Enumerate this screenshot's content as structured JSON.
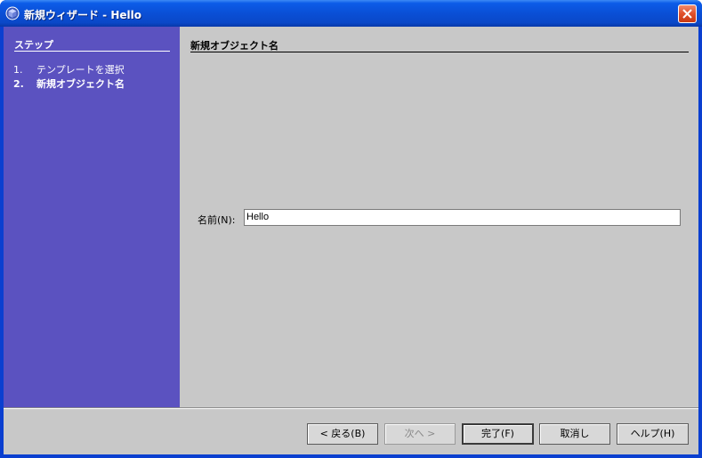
{
  "window": {
    "title": "新規ウィザード - Hello"
  },
  "steps": {
    "header": "ステップ",
    "items": [
      {
        "num": "1.",
        "label": "テンプレートを選択"
      },
      {
        "num": "2.",
        "label": "新規オブジェクト名"
      }
    ]
  },
  "content": {
    "header": "新規オブジェクト名",
    "name_label": "名前(N):",
    "name_value": "Hello"
  },
  "buttons": {
    "back": "< 戻る(B)",
    "next": "次へ >",
    "finish": "完了(F)",
    "cancel": "取消し",
    "help": "ヘルプ(H)"
  },
  "colors": {
    "titlebar": "#0a4fd6",
    "steps_panel": "#5b52c0",
    "client_bg": "#c8c8c8",
    "close_button": "#e0502a"
  }
}
